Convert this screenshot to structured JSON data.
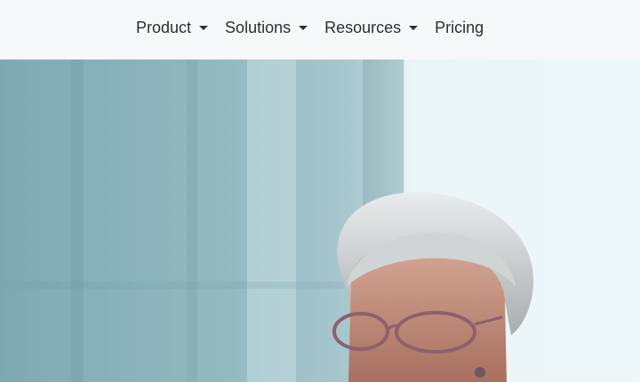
{
  "nav": {
    "items": [
      {
        "label": "Product",
        "has_dropdown": true,
        "icon": "caret-down-icon"
      },
      {
        "label": "Solutions",
        "has_dropdown": true,
        "icon": "caret-down-icon"
      },
      {
        "label": "Resources",
        "has_dropdown": true,
        "icon": "caret-down-icon"
      },
      {
        "label": "Pricing",
        "has_dropdown": false
      }
    ]
  },
  "hero": {
    "image": "older-woman-with-glasses-photo"
  },
  "colors": {
    "nav_background": "#f7f8f9",
    "nav_text": "#2b2f33",
    "hero_tint": "#8fb3bb"
  }
}
